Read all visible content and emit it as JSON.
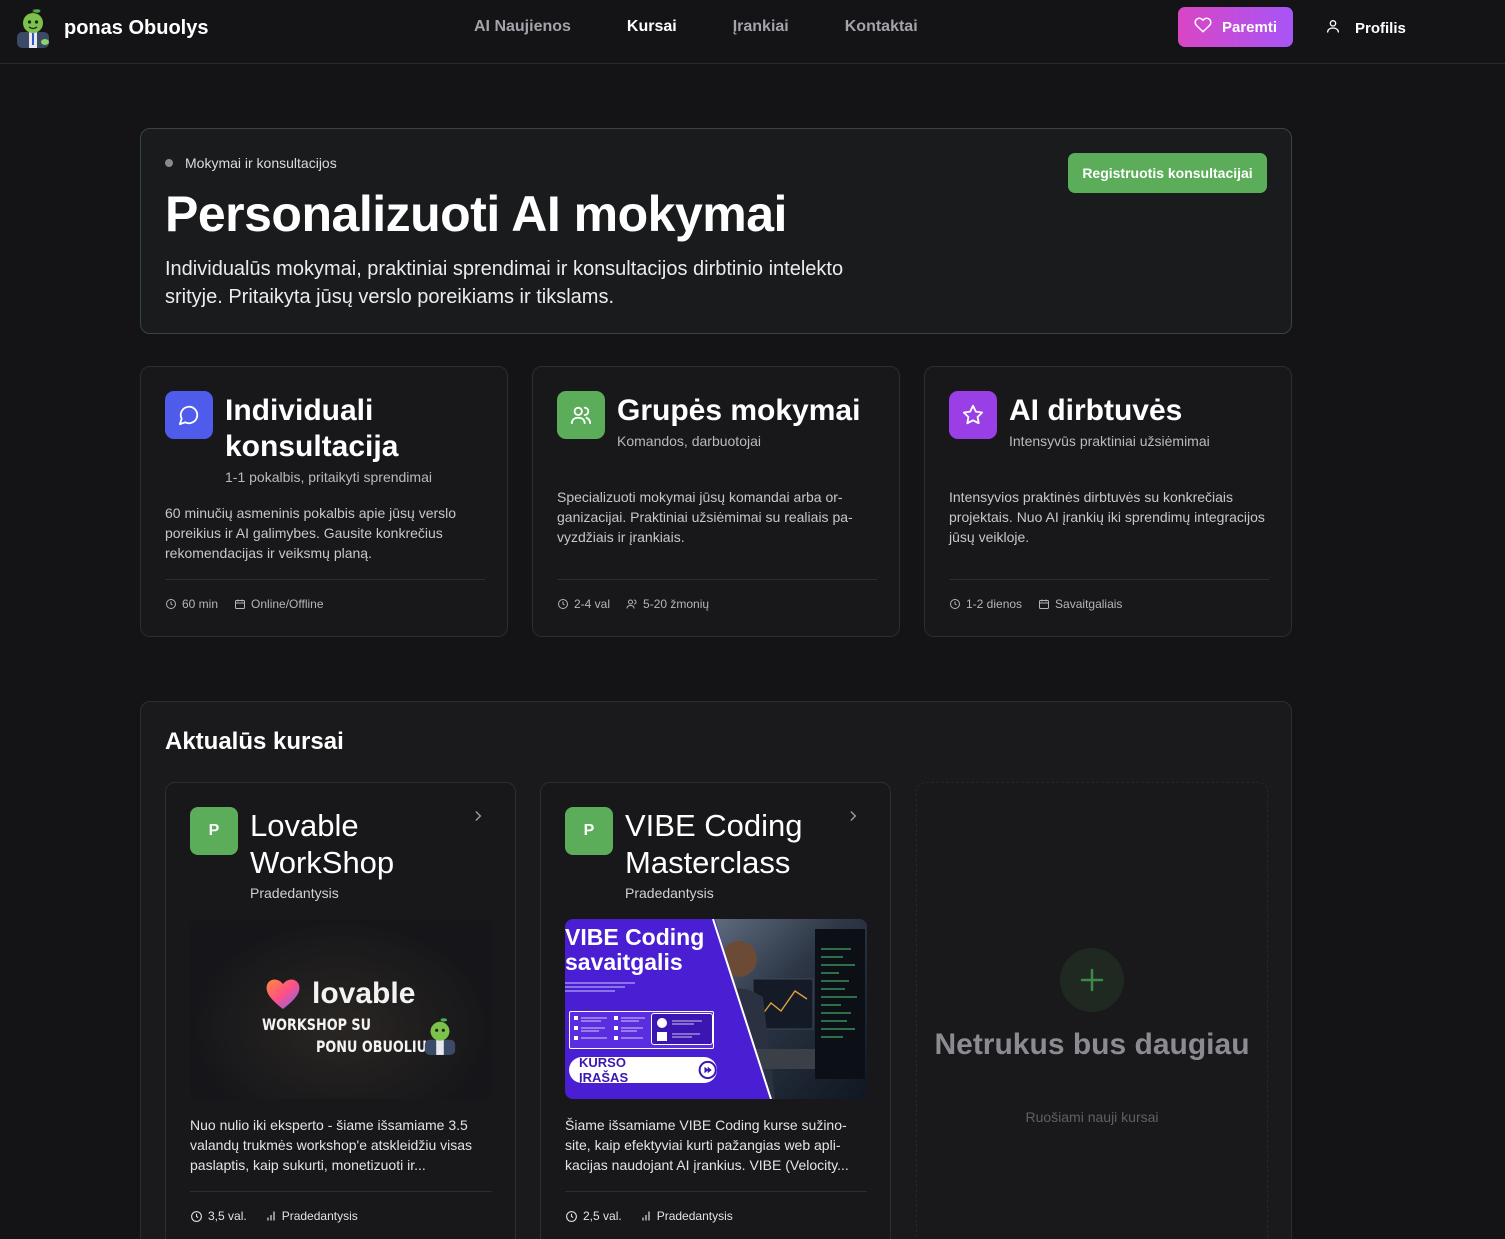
{
  "brand": {
    "name": "ponas Obuolys"
  },
  "nav": {
    "links": [
      "AI Naujienos",
      "Kursai",
      "Įrankiai",
      "Kontaktai"
    ],
    "active": "Kursai",
    "support_label": "Paremti",
    "profile_label": "Profilis"
  },
  "colors": {
    "accent_green": "#5cad5a",
    "support_gradient": [
      "#d946c5",
      "#a855f7"
    ],
    "blue": "#4f5bea",
    "purple": "#9a3ee6"
  },
  "hero": {
    "tag": "Mokymai ir konsultacijos",
    "title": "Personalizuoti AI mokymai",
    "description": "Individualūs mokymai, praktiniai sprendimai ir konsultacijos dirbtinio intelekto srityje. Pritaikyta jūsų verslo poreikiams ir tikslams.",
    "cta_label": "Registruotis konsultacijai"
  },
  "services": [
    {
      "icon": "chat-bubble-icon",
      "title": "Individuali konsultacija",
      "subtitle": "1-1 pokalbis, pritaikyti sprendimai",
      "description": "60 minučių asmeninis pokalbis apie jūsų verslo poreikius ir AI galimybes. Gausite konkrečius rekomendacijas ir veiksmų planą.",
      "meta": [
        "60 min",
        "Online/Offline"
      ]
    },
    {
      "icon": "users-icon",
      "title": "Grupės mokymai",
      "subtitle": "Komandos, darbuotojai",
      "description": "Specializuoti mokymai jūsų komandai arba or­ganizacijai. Praktiniai užsiėmimai su realiais pa­vyzdžiais ir įrankiais.",
      "meta": [
        "2-4 val",
        "5-20 žmonių"
      ]
    },
    {
      "icon": "star-icon",
      "title": "AI dirbtuvės",
      "subtitle": "Intensyvūs praktiniai užsiėmimai",
      "description": "Intensyvios praktinės dirbtuvės su konkrečiais projektais. Nuo AI įrankių iki sprendimų integra­cijos jūsų veikloje.",
      "meta": [
        "1-2 dienos",
        "Savaitgaliais"
      ]
    }
  ],
  "courses": {
    "title": "Aktualūs kursai",
    "items": [
      {
        "badge": "P",
        "title": "Lovable WorkShop",
        "level": "Pradedantysis",
        "image": {
          "logo_word": "lovable",
          "line1": "WORKSHOP SU",
          "line2": "PONU OBUOLIU"
        },
        "description": "Nuo nulio iki eksperto - šiame išsamiame 3.5 valandų trukmės workshop'e atskleidžiu vi­sas paslaptis, kaip sukurti, monetizuoti ir...",
        "duration": "3,5 val.",
        "meta_level": "Pradedantysis"
      },
      {
        "badge": "P",
        "title": "VIBE Coding Masterclass",
        "level": "Pradedantysis",
        "image": {
          "title_line1": "VIBE Coding",
          "title_line2": "savaitgalis",
          "button": "KURSO ĮRAŠAS"
        },
        "description": "Šiame išsamiame VIBE Coding kurse sužino­site, kaip efektyviai kurti pažangias web apli­kacijas naudojant AI įrankius. VIBE (Velocity...",
        "duration": "2,5 val.",
        "meta_level": "Pradedantysis"
      }
    ],
    "coming_soon": {
      "title": "Netrukus bus daugiau",
      "subtitle": "Ruošiami nauji kursai"
    }
  }
}
